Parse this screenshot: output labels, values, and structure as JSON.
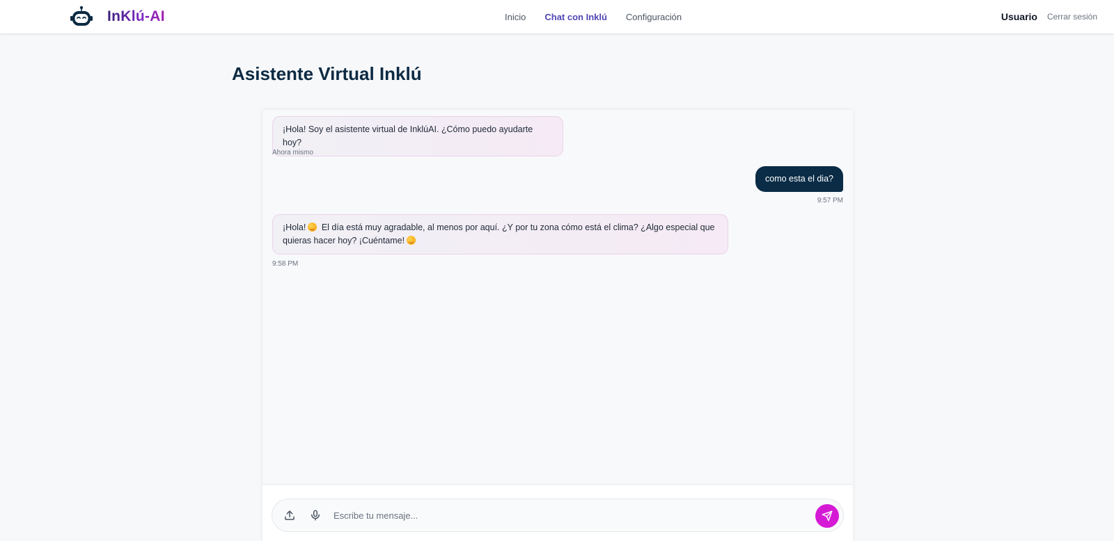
{
  "navbar": {
    "brand_name": "InKlú-AI",
    "links": [
      {
        "label": "Inicio",
        "active": false
      },
      {
        "label": "Chat con Inklú",
        "active": true
      },
      {
        "label": "Configuración",
        "active": false
      }
    ],
    "user_name": "Usuario",
    "logout_label": "Cerrar sesión"
  },
  "page": {
    "title": "Asistente Virtual Inklú"
  },
  "chat": {
    "messages": [
      {
        "sender": "bot",
        "text": "¡Hola! Soy el asistente virtual de InklúAI. ¿Cómo puedo ayudarte hoy?",
        "time": "Ahora mismo"
      },
      {
        "sender": "user",
        "text": "como esta el dia?",
        "time": "9:57 PM"
      },
      {
        "sender": "bot",
        "text_part1": "¡Hola!",
        "text_part2": "El día está muy agradable, al menos por aquí. ¿Y por tu zona cómo está el clima? ¿Algo especial que quieras hacer hoy? ¡Cuéntame!",
        "time": "9:58 PM"
      }
    ]
  },
  "input": {
    "placeholder": "Escribe tu mensaje...",
    "value": ""
  },
  "colors": {
    "accent": "#d51ad5",
    "user_bubble": "#0a2c46",
    "title": "#0c2a42",
    "nav_active": "#4f46b5"
  },
  "icons": {
    "brand": "robot-icon",
    "upload": "upload-icon",
    "mic": "microphone-icon",
    "send": "send-icon"
  }
}
